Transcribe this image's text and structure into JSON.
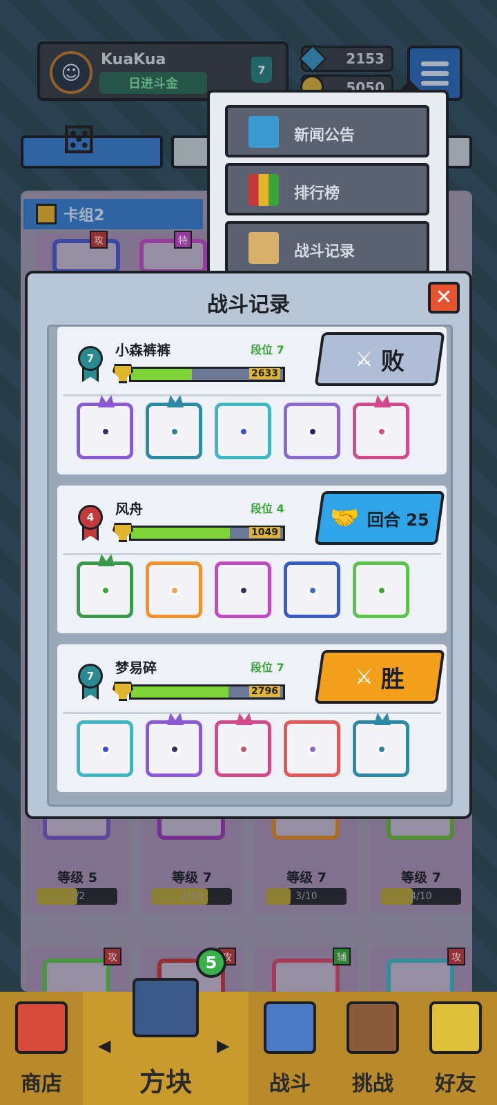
{
  "profile": {
    "username": "KuaKua",
    "title": "日进斗金",
    "rank": "7"
  },
  "currency": {
    "gems": "2153",
    "coins": "5050"
  },
  "menu": {
    "items": [
      {
        "label": "新闻公告",
        "icon": "news-icon"
      },
      {
        "label": "排行榜",
        "icon": "leaderboard-icon"
      },
      {
        "label": "战斗记录",
        "icon": "battle-record-icon"
      }
    ]
  },
  "deck": {
    "tab_label": "卡组2",
    "cards": [
      {
        "tag": "攻",
        "level": "等级 5",
        "progress": "1/2",
        "progress_fraction": 0.5
      },
      {
        "tag": "特",
        "level": "等级 7",
        "progress": "7/10",
        "progress_fraction": 0.7
      },
      {
        "tag": "",
        "level": "等级 7",
        "progress": "3/10",
        "progress_fraction": 0.3
      },
      {
        "tag": "",
        "level": "等级 7",
        "progress": "4/10",
        "progress_fraction": 0.4
      }
    ],
    "row2_tags": [
      "攻",
      "攻",
      "辅",
      "攻"
    ]
  },
  "modal": {
    "title": "战斗记录",
    "close_icon": "close-icon",
    "records": [
      {
        "name": "小森裤裤",
        "rank": "7",
        "rank_label": "段位 7",
        "score": "2633",
        "score_fraction": 0.4,
        "result": "败",
        "result_type": "defeat",
        "result_color": "#b0bdd6",
        "rank_color": "#2a8a8f",
        "cards": [
          {
            "color": "#8a5ad6",
            "dot": "#3a2a6a",
            "dragon": true
          },
          {
            "color": "#2d8aa4",
            "dot": "#2d7fa4",
            "dragon": true
          },
          {
            "color": "#3fb5c2",
            "dot": "#3c4ae0",
            "dragon": false
          },
          {
            "color": "#8a6ad0",
            "dot": "#2d1f6b",
            "dragon": false
          },
          {
            "color": "#d04a8c",
            "dot": "#d0526f",
            "dragon": true
          }
        ]
      },
      {
        "name": "风舟",
        "rank": "4",
        "rank_label": "段位 4",
        "score": "1049",
        "score_fraction": 0.65,
        "result": "回合 25",
        "result_type": "draw",
        "result_color": "#2fa4e8",
        "rank_color": "#c23a3a",
        "cards": [
          {
            "color": "#3a9a4a",
            "dot": "#3aa43a",
            "dragon": true
          },
          {
            "color": "#f0922c",
            "dot": "#f0a050",
            "dragon": false
          },
          {
            "color": "#c04ac4",
            "dot": "#3a2a6a",
            "dragon": false
          },
          {
            "color": "#3a5ac4",
            "dot": "#3a6ac4",
            "dragon": false
          },
          {
            "color": "#5ac44a",
            "dot": "#3aa43a",
            "dragon": false
          }
        ]
      },
      {
        "name": "梦易碎",
        "rank": "7",
        "rank_label": "段位 7",
        "score": "2796",
        "score_fraction": 0.64,
        "result": "胜",
        "result_type": "victory",
        "result_color": "#f2a01c",
        "rank_color": "#2a8a8f",
        "cards": [
          {
            "color": "#3fb5c2",
            "dot": "#3c4ae0",
            "dragon": false
          },
          {
            "color": "#8a5ad6",
            "dot": "#3a2a6a",
            "dragon": true
          },
          {
            "color": "#d04a8c",
            "dot": "#d0526f",
            "dragon": true
          },
          {
            "color": "#e05a5a",
            "dot": "#8a6ad0",
            "dragon": false
          },
          {
            "color": "#2d8aa4",
            "dot": "#2d7fa4",
            "dragon": true
          }
        ]
      }
    ]
  },
  "nav": {
    "items": [
      {
        "label": "商店",
        "icon": "shop-icon"
      },
      {
        "label": "方块",
        "icon": "cube-icon",
        "badge": "5"
      },
      {
        "label": "战斗",
        "icon": "battle-icon"
      },
      {
        "label": "挑战",
        "icon": "challenge-icon"
      },
      {
        "label": "好友",
        "icon": "friends-icon"
      }
    ]
  }
}
